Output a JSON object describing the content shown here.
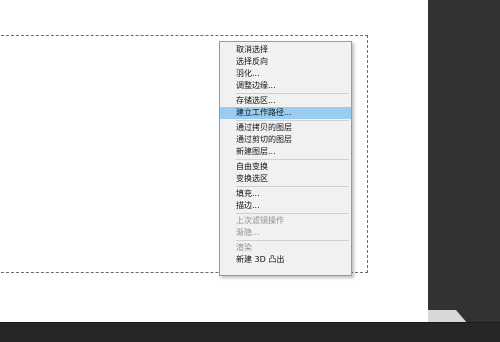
{
  "context_menu": {
    "items": [
      {
        "label": "取消选择"
      },
      {
        "label": "选择反向"
      },
      {
        "label": "羽化..."
      },
      {
        "label": "调整边缘..."
      },
      {
        "label": "存储选区..."
      },
      {
        "label": "建立工作路径..."
      },
      {
        "label": "通过拷贝的图层"
      },
      {
        "label": "通过剪切的图层"
      },
      {
        "label": "新建图层..."
      },
      {
        "label": "自由变换"
      },
      {
        "label": "变换选区"
      },
      {
        "label": "填充..."
      },
      {
        "label": "描边..."
      },
      {
        "label": "上次滤镜操作"
      },
      {
        "label": "渐隐..."
      },
      {
        "label": "渲染"
      },
      {
        "label": "新建 3D 凸出"
      }
    ],
    "highlighted_item": "建立工作路径...",
    "disabled_items": [
      "上次滤镜操作",
      "渐隐...",
      "渲染"
    ]
  },
  "colors": {
    "menu_background": "#f1f1f1",
    "highlight": "#99ccf0",
    "panel_background": "#323232",
    "bottom_bar": "#262626"
  }
}
